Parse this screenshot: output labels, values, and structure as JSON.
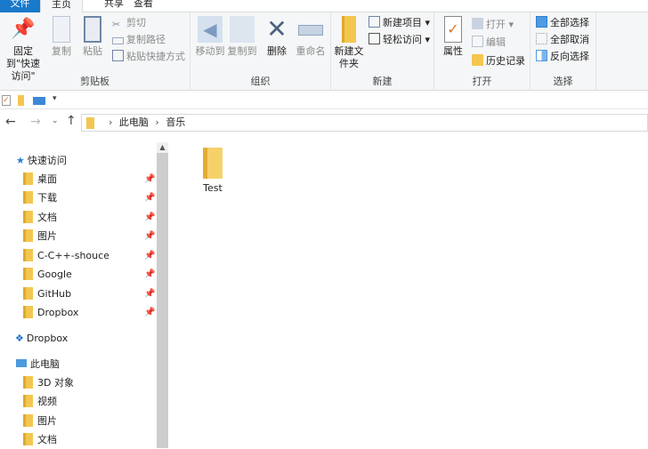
{
  "tabs": {
    "file": "文件",
    "home": "主页",
    "share": "共享",
    "view": "查看"
  },
  "ribbon": {
    "clipboard": {
      "label": "剪贴板",
      "pin": "固定到\"快速访问\"",
      "copy": "复制",
      "paste": "粘贴",
      "cut": "剪切",
      "copy_path": "复制路径",
      "paste_shortcut": "粘贴快捷方式"
    },
    "organize": {
      "label": "组织",
      "move_to": "移动到",
      "copy_to": "复制到",
      "delete": "删除",
      "rename": "重命名"
    },
    "new": {
      "label": "新建",
      "new_folder": "新建文件夹",
      "new_item": "新建项目",
      "easy_access": "轻松访问"
    },
    "open": {
      "label": "打开",
      "properties": "属性",
      "open": "打开",
      "edit": "编辑",
      "history": "历史记录"
    },
    "select": {
      "label": "选择",
      "select_all": "全部选择",
      "select_none": "全部取消",
      "invert": "反向选择"
    }
  },
  "breadcrumb": [
    "此电脑",
    "音乐"
  ],
  "nav": {
    "quick_access": "快速访问",
    "quick_items": [
      "桌面",
      "下载",
      "文档",
      "图片",
      "C-C++-shouce",
      "Google",
      "GitHub",
      "Dropbox"
    ],
    "dropbox": "Dropbox",
    "this_pc": "此电脑",
    "pc_items": [
      "3D 对象",
      "视频",
      "图片",
      "文档"
    ]
  },
  "files": [
    {
      "name": "Test",
      "type": "folder"
    }
  ]
}
